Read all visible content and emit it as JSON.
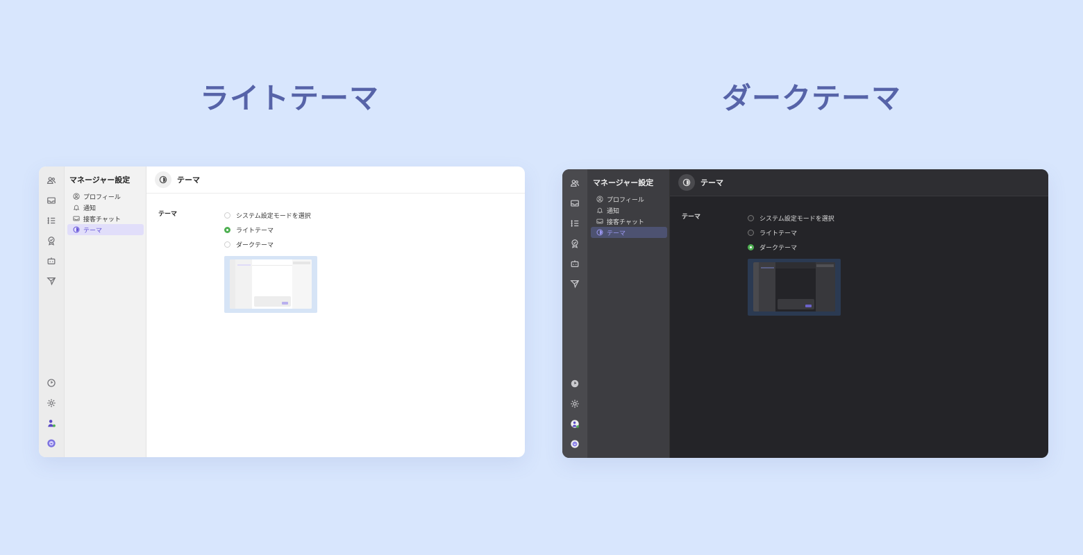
{
  "light": {
    "heading": "ライトテーマ",
    "settings_title": "マネージャー設定",
    "nav": [
      "プロフィール",
      "通知",
      "接客チャット",
      "テーマ"
    ],
    "header_title": "テーマ",
    "field_label": "テーマ",
    "options": [
      "システム設定モードを選択",
      "ライトテーマ",
      "ダークテーマ"
    ],
    "selected_option": "ライトテーマ"
  },
  "dark": {
    "heading": "ダークテーマ",
    "settings_title": "マネージャー設定",
    "nav": [
      "プロフィール",
      "通知",
      "接客チャット",
      "テーマ"
    ],
    "header_title": "テーマ",
    "field_label": "テーマ",
    "options": [
      "システム設定モードを選択",
      "ライトテーマ",
      "ダークテーマ"
    ],
    "selected_option": "ダークテーマ"
  },
  "colors": {
    "page_background": "#d8e6fd",
    "heading": "#5663a8",
    "accent_purple": "#6250d7",
    "radio_checked_green": "#4fb052"
  },
  "icons": {
    "rail_top": [
      "users-icon",
      "inbox-icon",
      "list-icon",
      "badge-icon",
      "bot-icon",
      "send-icon"
    ],
    "rail_bottom": [
      "clock-icon",
      "gear-icon",
      "user-status-icon",
      "avatar-icon"
    ],
    "nav": [
      "profile-icon",
      "bell-icon",
      "chat-icon",
      "theme-icon"
    ]
  }
}
